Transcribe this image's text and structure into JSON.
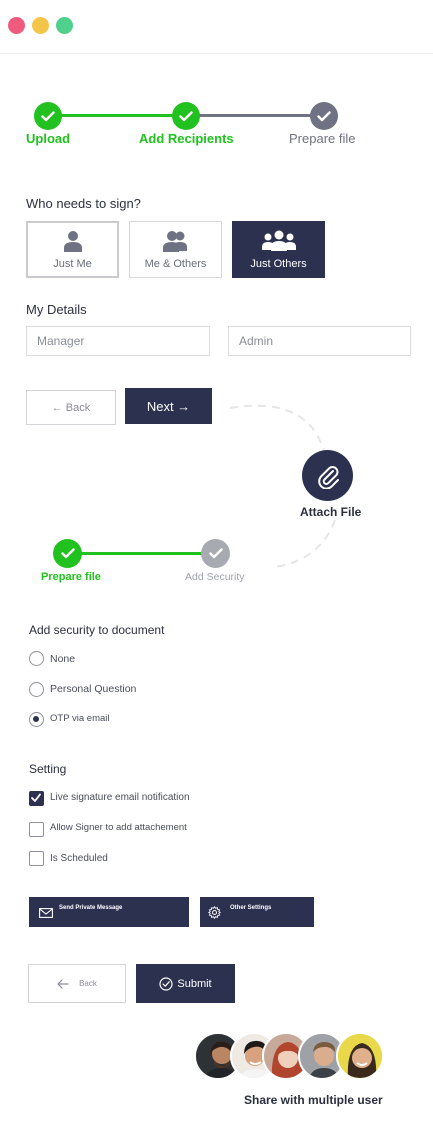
{
  "stepper_top": {
    "steps": [
      {
        "label": "Upload",
        "state": "done"
      },
      {
        "label": "Add Recipients",
        "state": "done"
      },
      {
        "label": "Prepare file",
        "state": "pending"
      }
    ]
  },
  "signers": {
    "heading": "Who needs to sign?",
    "options": [
      {
        "label": "Just Me",
        "icon": "user-icon"
      },
      {
        "label": "Me & Others",
        "icon": "users-icon"
      },
      {
        "label": "Just Others",
        "icon": "group-icon",
        "selected": true
      }
    ]
  },
  "details": {
    "heading": "My Details",
    "field1_placeholder": "Manager",
    "field2_placeholder": "Admin"
  },
  "nav": {
    "back_label": "← Back",
    "next_label": "Next →"
  },
  "attach": {
    "label": "Attach File",
    "icon": "paperclip-icon"
  },
  "stepper_bottom": {
    "steps": [
      {
        "label": "Prepare file",
        "state": "done"
      },
      {
        "label": "Add Security",
        "state": "pending"
      }
    ]
  },
  "security": {
    "heading": "Add security to document",
    "options": [
      {
        "label": "None",
        "checked": false
      },
      {
        "label": "Personal Question",
        "checked": false
      },
      {
        "label": "OTP via email",
        "checked": true
      }
    ]
  },
  "settings": {
    "heading": "Setting",
    "options": [
      {
        "label": "Live signature email notification",
        "checked": true
      },
      {
        "label": "Allow Signer to add attachement",
        "checked": false
      },
      {
        "label": "Is Scheduled",
        "checked": false
      }
    ],
    "private_message_label": "Send Private Message",
    "other_settings_label": "Other Settings"
  },
  "footer": {
    "back_label": "Back",
    "submit_label": "Submit",
    "share_label": "Share with multiple user"
  },
  "colors": {
    "accent_green": "#21c21f",
    "dark_navy": "#2c3150",
    "pending_gray": "#6f7282"
  }
}
